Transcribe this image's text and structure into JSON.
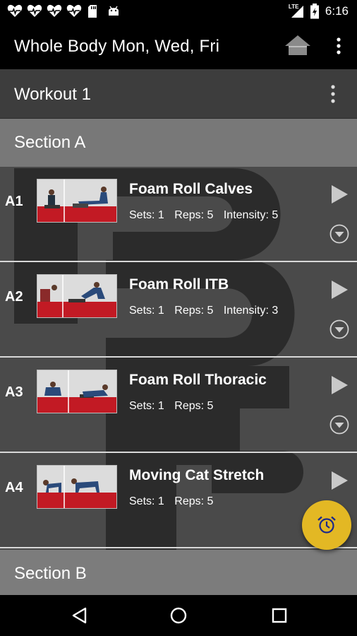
{
  "status_bar": {
    "time": "6:16",
    "network": "LTE",
    "notification_icons": [
      "heart-pulse-icon",
      "heart-pulse-icon",
      "heart-pulse-icon",
      "heart-pulse-icon",
      "sd-card-icon",
      "android-icon"
    ],
    "battery_level": 0.7
  },
  "app_bar": {
    "title": "Whole Body Mon, Wed, Fri",
    "home_icon": "home-icon",
    "menu_icon": "more-vert-icon"
  },
  "workout": {
    "title": "Workout 1",
    "menu_icon": "more-vert-icon"
  },
  "sections": [
    {
      "title": "Section A",
      "exercises": [
        {
          "code": "A1",
          "name": "Foam Roll Calves",
          "sets": "Sets: 1",
          "reps": "Reps: 5",
          "intensity": "Intensity: 5",
          "expandable": true
        },
        {
          "code": "A2",
          "name": "Foam Roll ITB",
          "sets": "Sets: 1",
          "reps": "Reps: 5",
          "intensity": "Intensity: 3",
          "expandable": true
        },
        {
          "code": "A3",
          "name": "Foam Roll Thoracic",
          "sets": "Sets: 1",
          "reps": "Reps: 5",
          "intensity": "",
          "expandable": true
        },
        {
          "code": "A4",
          "name": "Moving Cat Stretch",
          "sets": "Sets: 1",
          "reps": "Reps: 5",
          "intensity": "",
          "expandable": false
        }
      ]
    },
    {
      "title": "Section B",
      "exercises": []
    }
  ],
  "fab": {
    "icon": "alarm-clock-icon"
  },
  "colors": {
    "accent": "#e3b824",
    "section_header": "#7c7c7c",
    "workout_header": "#3d3d3d",
    "row_bg": "#4a4a4a"
  },
  "nav_bar": {
    "back_icon": "back-triangle-icon",
    "home_icon": "home-circle-icon",
    "recents_icon": "recents-square-icon"
  }
}
